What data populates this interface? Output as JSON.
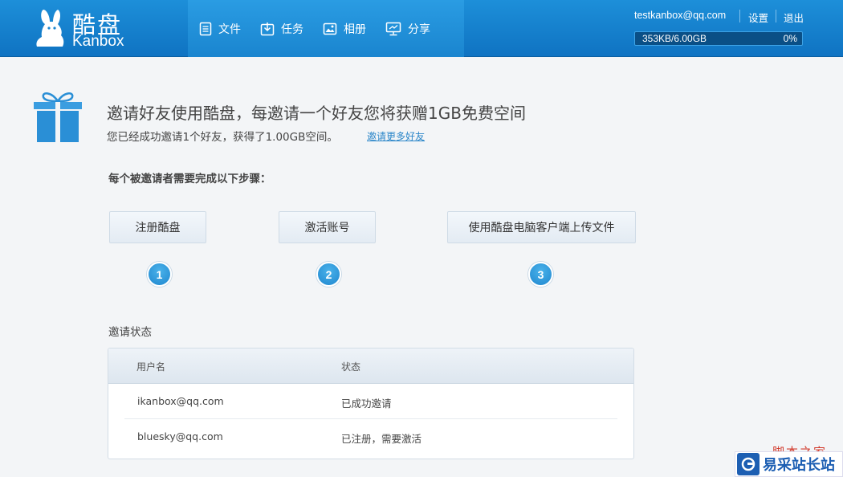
{
  "header": {
    "logo_cn": "酷盘",
    "logo_en": "Kanbox",
    "nav": [
      {
        "label": "文件",
        "icon": "file-icon"
      },
      {
        "label": "任务",
        "icon": "task-icon"
      },
      {
        "label": "相册",
        "icon": "album-icon"
      },
      {
        "label": "分享",
        "icon": "share-icon"
      }
    ],
    "user_email": "testkanbox@qq.com",
    "settings_label": "设置",
    "logout_label": "退出",
    "quota_used": "353KB/6.00GB",
    "quota_percent": "0%",
    "quota_fraction": 0.0
  },
  "invite": {
    "headline": "邀请好友使用酷盘，每邀请一个好友您将获赠1GB免费空间",
    "summary": "您已经成功邀请1个好友，获得了1.00GB空间。",
    "invite_more_label": "邀请更多好友",
    "steps_title": "每个被邀请者需要完成以下步骤：",
    "steps": [
      {
        "label": "注册酷盘",
        "number": "1"
      },
      {
        "label": "激活账号",
        "number": "2"
      },
      {
        "label": "使用酷盘电脑客户端上传文件",
        "number": "3"
      }
    ]
  },
  "status": {
    "title": "邀请状态",
    "columns": [
      "用户名",
      "状态"
    ],
    "rows": [
      {
        "username": "ikanbox@qq.com",
        "state": "已成功邀请"
      },
      {
        "username": "bluesky@qq.com",
        "state": "已注册，需要激活"
      }
    ]
  },
  "watermark": {
    "text1": "脚本之家",
    "text2": "易采站长站"
  },
  "colors": {
    "header_blue": "#1a85cf",
    "accent": "#2b86c9",
    "step_circle": "#1f87cf"
  }
}
